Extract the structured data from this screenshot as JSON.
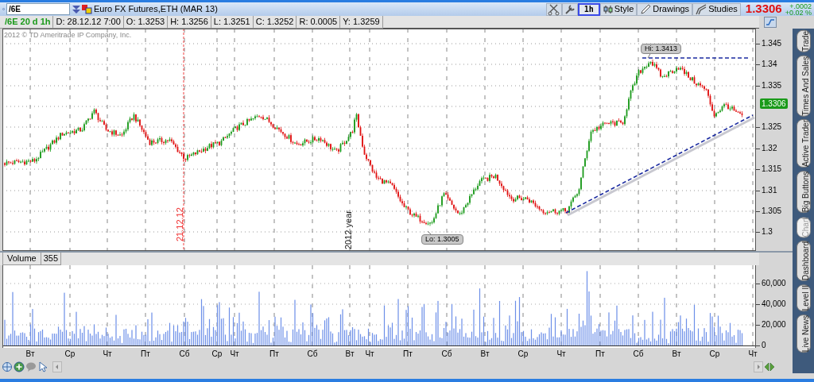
{
  "symbol_field": {
    "value": "/6E"
  },
  "instrument": "Euro FX Futures,ETH (MAR 13)",
  "toolbar_buttons": [
    {
      "label": "1h",
      "kind": "interval",
      "selected": true
    },
    {
      "label": "Style",
      "kind": "style",
      "selected": false
    },
    {
      "label": "Drawings",
      "kind": "drawings",
      "selected": false
    },
    {
      "label": "Studies",
      "kind": "studies",
      "selected": false
    }
  ],
  "last_price": "1.3306",
  "change": "+.0002",
  "change_percent": "+0.02 %",
  "info_bar": [
    {
      "text": "/6E 20 d 1h",
      "kind": "title"
    },
    {
      "text": "D: 28.12.12 7:00",
      "kind": "field"
    },
    {
      "text": "O: 1.3253",
      "kind": "field"
    },
    {
      "text": "H: 1.3256",
      "kind": "field"
    },
    {
      "text": "L: 1.3251",
      "kind": "field"
    },
    {
      "text": "C: 1.3252",
      "kind": "field"
    },
    {
      "text": "R: 0.0005",
      "kind": "field"
    },
    {
      "text": "Y: 1.3259",
      "kind": "field"
    }
  ],
  "chart": {
    "copyright": "2012 © TD Ameritrade IP Company, Inc.",
    "markers": [
      {
        "label": "21.12.12",
        "kind": "date"
      },
      {
        "label": "2012 year",
        "kind": "year"
      }
    ],
    "high_label": "Hi: 1.3413",
    "low_label": "Lo: 1.3005",
    "price_axis": [
      "1.345",
      "1.34",
      "1.335",
      "1.325",
      "1.32",
      "1.315",
      "1.31",
      "1.305",
      "1.3"
    ],
    "current_price": "1.3306"
  },
  "volume": {
    "title": "Volume",
    "value": "355",
    "axis": [
      "60,000",
      "40,000",
      "20,000",
      "0"
    ]
  },
  "time_axis": [
    "Вт",
    "Ср",
    "Чт",
    "Пт",
    "Сб",
    "Ср",
    "Чт",
    "Пт",
    "Сб",
    "Вт",
    "Чт",
    "Пт",
    "Сб",
    "Вт",
    "Ср",
    "Чт",
    "Пт",
    "Сб",
    "Вт",
    "Ср",
    "Чт"
  ],
  "side_tabs": [
    {
      "label": "Trade",
      "selected": false
    },
    {
      "label": "Times And Sales",
      "selected": false
    },
    {
      "label": "Active Trader",
      "selected": false
    },
    {
      "label": "Big Buttons",
      "selected": false
    },
    {
      "label": "Chart",
      "selected": true
    },
    {
      "label": "Dashboard",
      "selected": false
    },
    {
      "label": "Level II",
      "selected": false
    },
    {
      "label": "Live News",
      "selected": false
    }
  ]
}
